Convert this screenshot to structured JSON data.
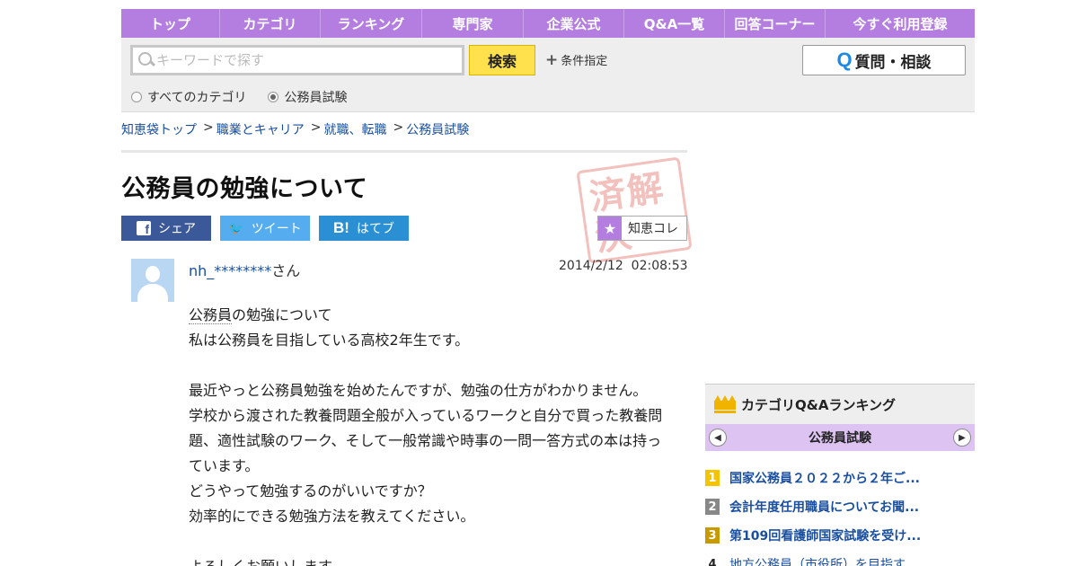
{
  "nav": {
    "items": [
      {
        "label": "トップ",
        "width": 110
      },
      {
        "label": "カテゴリ",
        "width": 112
      },
      {
        "label": "ランキング",
        "width": 113
      },
      {
        "label": "専門家",
        "width": 113
      },
      {
        "label": "企業公式",
        "width": 112
      },
      {
        "label": "Q&A一覧",
        "width": 112
      },
      {
        "label": "回答コーナー",
        "width": 112
      },
      {
        "label": "今すぐ利用登録",
        "width": 166
      }
    ]
  },
  "search": {
    "placeholder": "キーワードで探す",
    "button_label": "検索",
    "condition_label": "条件指定",
    "ask_label": "質問・相談",
    "scope_all": "すべてのカテゴリ",
    "scope_current": "公務員試験"
  },
  "breadcrumb": {
    "items": [
      "知恵袋トップ",
      "職業とキャリア",
      "就職、転職",
      "公務員試験"
    ]
  },
  "question": {
    "title": "公務員の勉強について",
    "stamp_text": "済解決",
    "user_name": "nh_********",
    "user_suffix": "さん",
    "date": "2014/2/12  02:08:53",
    "body_keyword": "公務員",
    "body_first_rest": "の勉強について",
    "body": [
      "私は公務員を目指している高校2年生です。",
      "",
      "最近やっと公務員勉強を始めたんですが、勉強の仕方がわかりません。",
      "学校から渡された教養問題全般が入っているワークと自分で買った教養問題、適性試験のワーク、そして一般常識や時事の一問一答方式の本は持っています。",
      "どうやって勉強するのがいいですか？",
      "効率的にできる勉強方法を教えてください。",
      "",
      "よろしくお願いします。"
    ]
  },
  "share": {
    "facebook": "シェア",
    "twitter": "ツイート",
    "hatena": "はてブ",
    "chiekore": "知恵コレ"
  },
  "ranking": {
    "title": "カテゴリQ&Aランキング",
    "category": "公務員試験",
    "items": [
      {
        "rank": "1",
        "text": "国家公務員２０２２から２年ご..."
      },
      {
        "rank": "2",
        "text": "会計年度任用職員についてお聞..."
      },
      {
        "rank": "3",
        "text": "第109回看護師国家試験を受け..."
      },
      {
        "rank": "4",
        "text": "地方公務員（市役所）を目指す..."
      }
    ],
    "colors": {
      "1": "#f5c400",
      "2": "#888888",
      "3": "#c89a00",
      "4": "transparent"
    }
  }
}
